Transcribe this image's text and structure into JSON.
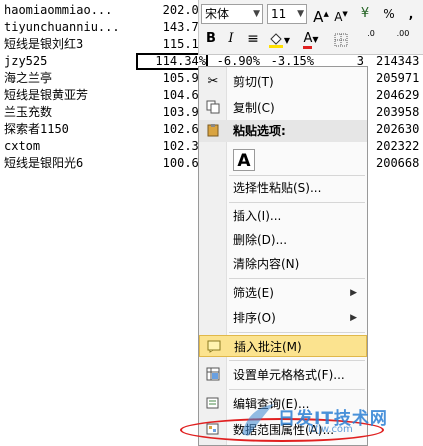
{
  "sheet": {
    "rows": [
      {
        "name": "haomiaommiao...",
        "value": "202.07",
        "pct": "",
        "n": "",
        "id": ""
      },
      {
        "name": "tiyunchuanniu...",
        "value": "143.72",
        "pct": "",
        "n": "",
        "id": ""
      },
      {
        "name": "短线是银刘红3",
        "value": "115.12",
        "pct": "",
        "n": "",
        "id": ""
      },
      {
        "name": "jzy525",
        "value": "114.34%",
        "pct": "-6.90%",
        "n": "3",
        "id": "214343"
      },
      {
        "name": "海之兰亭",
        "value": "105.97",
        "pct": "",
        "n": "",
        "id": "205971"
      },
      {
        "name": "短线是银黄亚芳",
        "value": "104.62",
        "pct": "",
        "n": "",
        "id": "204629"
      },
      {
        "name": "兰玉充数",
        "value": "103.96",
        "pct": "",
        "n": "",
        "id": "203958"
      },
      {
        "name": "探索者1150",
        "value": "102.62",
        "pct": "",
        "n": "",
        "id": "202630"
      },
      {
        "name": "cxtom",
        "value": "102.33",
        "pct": "",
        "n": "",
        "id": "202322"
      },
      {
        "name": "短线是银阳光6",
        "value": "100.66",
        "pct": "",
        "n": "",
        "id": "200668"
      }
    ],
    "extra_pct": "-3.15%"
  },
  "mini_toolbar": {
    "font_name": "宋体",
    "font_size": "11",
    "grow_font": "A",
    "shrink_font": "A",
    "currency": "¥",
    "percent": "%",
    "comma": ",",
    "bold": "B",
    "italic": "I",
    "align": "≡",
    "font_color": "A",
    "dec_inc": ".0",
    "dec_dec": ".00",
    "accent_font_color": "#e02020",
    "accent_fill_color": "#ffe000"
  },
  "menu": {
    "cut": "剪切(T)",
    "copy": "复制(C)",
    "paste_options": "粘贴选项:",
    "paste_glyph": "A",
    "paste_special": "选择性粘贴(S)...",
    "insert": "插入(I)...",
    "delete": "删除(D)...",
    "clear": "清除内容(N)",
    "filter": "筛选(E)",
    "sort": "排序(O)",
    "insert_comment": "插入批注(M)",
    "format_cells": "设置单元格格式(F)...",
    "edit_query": "编辑查询(E)...",
    "data_range": "数据范围属性(A)..."
  },
  "watermark": {
    "text": "日发IT技术网",
    "url": "itfjw.com"
  }
}
